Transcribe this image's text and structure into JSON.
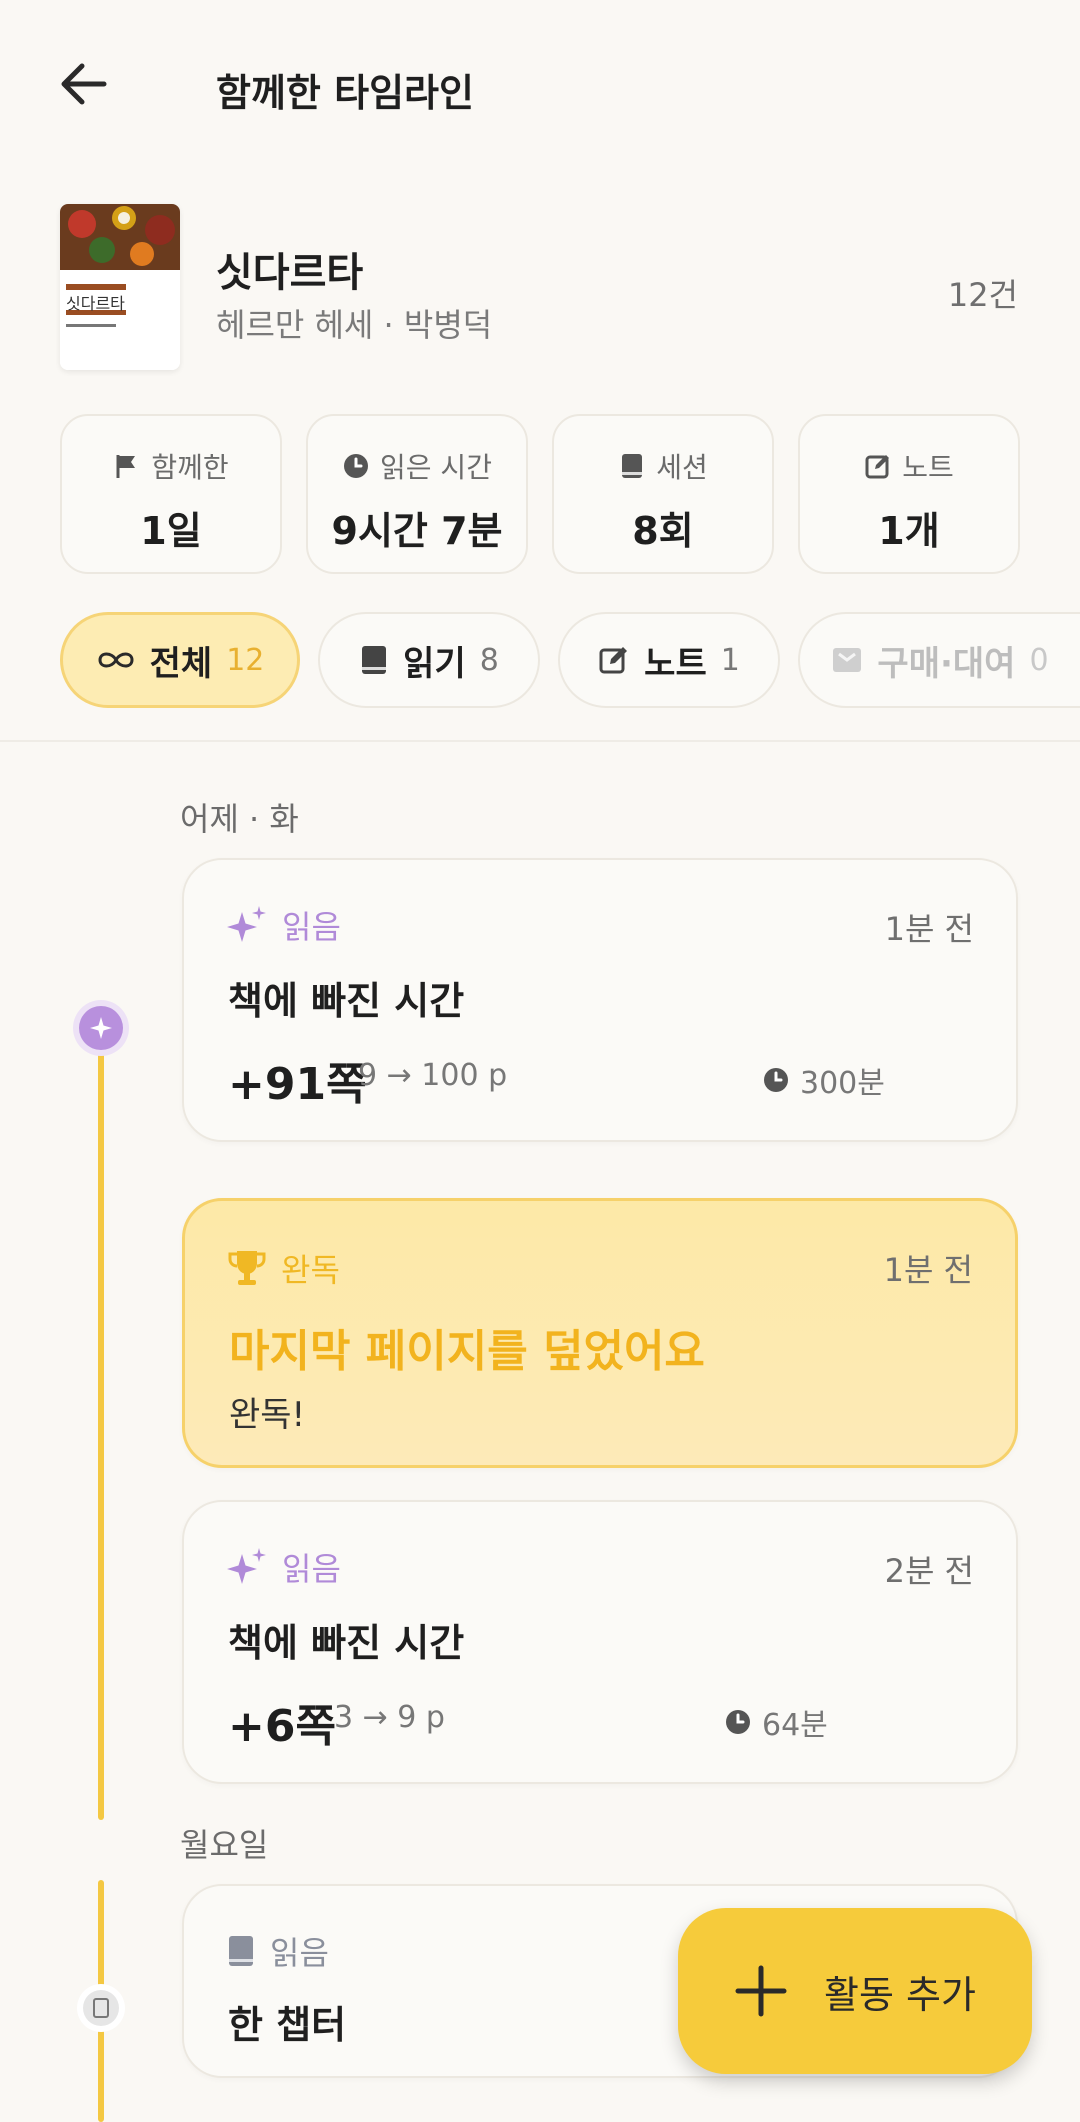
{
  "header": {
    "title": "함께한 타임라인"
  },
  "book": {
    "title": "싯다르타",
    "author": "헤르만 헤세 · 박병덕",
    "count": "12건",
    "cover_title": "싯다르타"
  },
  "stats": [
    {
      "label": "함께한",
      "value": "1일",
      "icon": "flag-icon"
    },
    {
      "label": "읽은 시간",
      "value": "9시간 7분",
      "icon": "clock-icon"
    },
    {
      "label": "세션",
      "value": "8회",
      "icon": "book-icon"
    },
    {
      "label": "노트",
      "value": "1개",
      "icon": "edit-icon"
    }
  ],
  "filters": [
    {
      "label": "전체",
      "count": "12",
      "icon": "infinity-icon"
    },
    {
      "label": "읽기",
      "count": "8",
      "icon": "book-icon"
    },
    {
      "label": "노트",
      "count": "1",
      "icon": "edit-icon"
    },
    {
      "label": "구매·대여",
      "count": "0",
      "icon": "bag-icon"
    }
  ],
  "timeline": {
    "day1": "어제 · 화",
    "day2": "월요일",
    "cards": [
      {
        "type": "읽음",
        "time": "1분 전",
        "title": "책에 빠진 시간",
        "pages": "+91쪽",
        "range": "9 → 100 p",
        "duration": "300분"
      },
      {
        "type": "완독",
        "time": "1분 전",
        "title": "마지막 페이지를 덮었어요",
        "sub": "완독!"
      },
      {
        "type": "읽음",
        "time": "2분 전",
        "title": "책에 빠진 시간",
        "pages": "+6쪽",
        "range": "3 → 9 p",
        "duration": "64분"
      },
      {
        "type": "읽음",
        "title": "한 챕터"
      }
    ]
  },
  "fab": {
    "label": "활동 추가"
  },
  "colors": {
    "accent": "#f6cb3b",
    "sparkle": "#b08ad8",
    "trophy": "#f0b824",
    "timeline": "#f4c842"
  }
}
